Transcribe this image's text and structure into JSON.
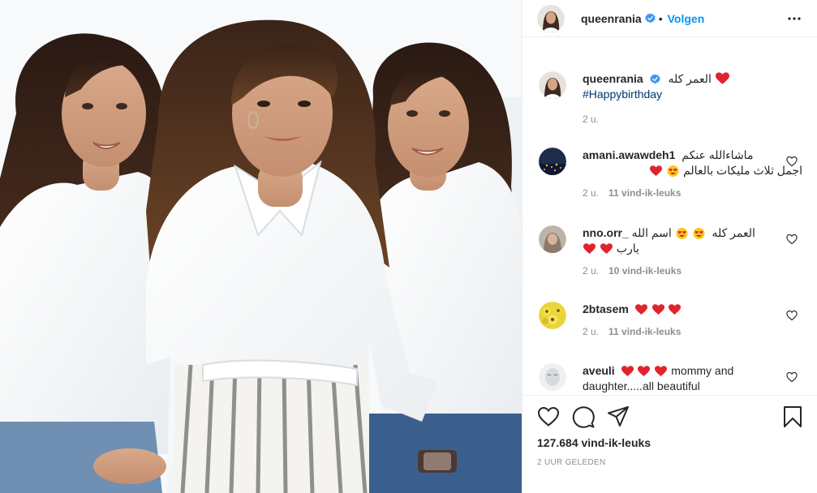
{
  "post": {
    "username": "queenrania",
    "follow_label": "Volgen",
    "dot": "•",
    "caption": {
      "username": "queenrania",
      "text": "العمر كله",
      "hashtag": "#Happybirthday",
      "time": "2 u."
    },
    "comments": [
      {
        "username": "amani.awawdeh1",
        "text_line1": "ماشاءالله عنكم",
        "text_line2": "اجمل ثلاث مليكات بالعالم",
        "time": "2 u.",
        "likes": "11 vind-ik-leuks",
        "avatar": "night-city-avatar"
      },
      {
        "username": "nno.orr_",
        "text_line1": "العمر كله",
        "text_line1b": "اسم الله",
        "text_line2": "يارب",
        "time": "2 u.",
        "likes": "10 vind-ik-leuks",
        "avatar": "portrait-avatar"
      },
      {
        "username": "2btasem",
        "text": "",
        "time": "2 u.",
        "likes": "11 vind-ik-leuks",
        "avatar": "sunflower-avatar"
      },
      {
        "username": "aveuli",
        "text": "mommy and daughter.....all beautiful",
        "avatar": "sketch-avatar"
      }
    ],
    "likes_total": "127.684 vind-ik-leuks",
    "posted": "2 UUR GELEDEN"
  },
  "colors": {
    "accent": "#0095f6",
    "hashtag": "#00376b",
    "secondary_text": "#8e8e8e",
    "heart_emoji": "#e0242e"
  },
  "icons": [
    "verified-badge-icon",
    "more-options-icon",
    "like-heart-icon",
    "comment-icon",
    "share-icon",
    "save-bookmark-icon"
  ]
}
